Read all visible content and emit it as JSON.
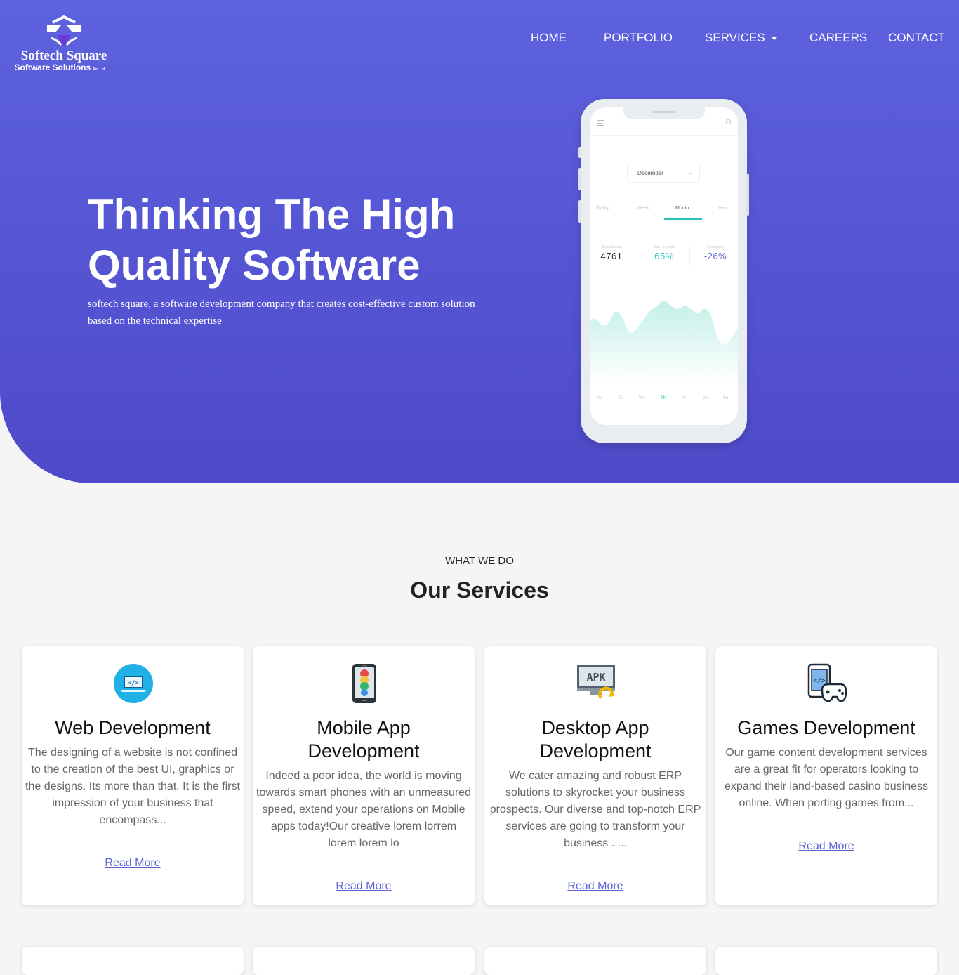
{
  "brand": {
    "name": "Softech Square",
    "subtitle": "Software Solutions",
    "suffix": "Pvt Ltd"
  },
  "nav": {
    "home": "HOME",
    "portfolio": "PORTFOLIO",
    "services": "SERVICES",
    "careers": "CAREERS",
    "contact": "CONTACT"
  },
  "hero": {
    "title": "Thinking The High Quality Software",
    "description": "softech square, a software development company that creates cost-effective custom solution based on the technical expertise"
  },
  "phone": {
    "month": "December",
    "periods": [
      "Today",
      "Week",
      "Month",
      "Year"
    ],
    "active_period": "Month",
    "stats": [
      {
        "label": "Overall data",
        "value": "4761"
      },
      {
        "label": "Date on time",
        "value": "65%"
      },
      {
        "label": "Summary",
        "value": "-26%"
      }
    ],
    "days": [
      "Mo",
      "Tu",
      "We",
      "Th",
      "Fr",
      "Sa",
      "Su"
    ]
  },
  "services": {
    "kicker": "WHAT WE DO",
    "title": "Our Services",
    "cards": [
      {
        "title": "Web Development",
        "text": "The designing of a website is not confined to the creation of the best UI, graphics or the designs. Its more than that. It is the first impression of your business that encompass...",
        "link": "Read More",
        "icon": "web-code-icon"
      },
      {
        "title": "Mobile App Development",
        "text": "Indeed a poor idea, the world is moving towards smart phones with an unmeasured speed, extend your operations on Mobile apps today!Our creative lorem lorrem lorem lorem lo",
        "link": "Read More",
        "icon": "mobile-app-icon"
      },
      {
        "title": "Desktop App Development",
        "text": "We cater amazing and robust ERP solutions to skyrocket your business prospects. Our diverse and top-notch ERP services are going to transform your business .....",
        "link": "Read More",
        "icon": "apk-monitor-icon"
      },
      {
        "title": "Games Development",
        "text": "Our game content development services are a great fit for operators looking to expand their land-based casino business online. When porting games from...",
        "link": "Read More",
        "icon": "game-controller-icon"
      }
    ]
  },
  "colors": {
    "hero_top": "#5d62de",
    "hero_bottom": "#4e4ac9",
    "teal": "#27c3b2",
    "link": "#5a63d4"
  }
}
